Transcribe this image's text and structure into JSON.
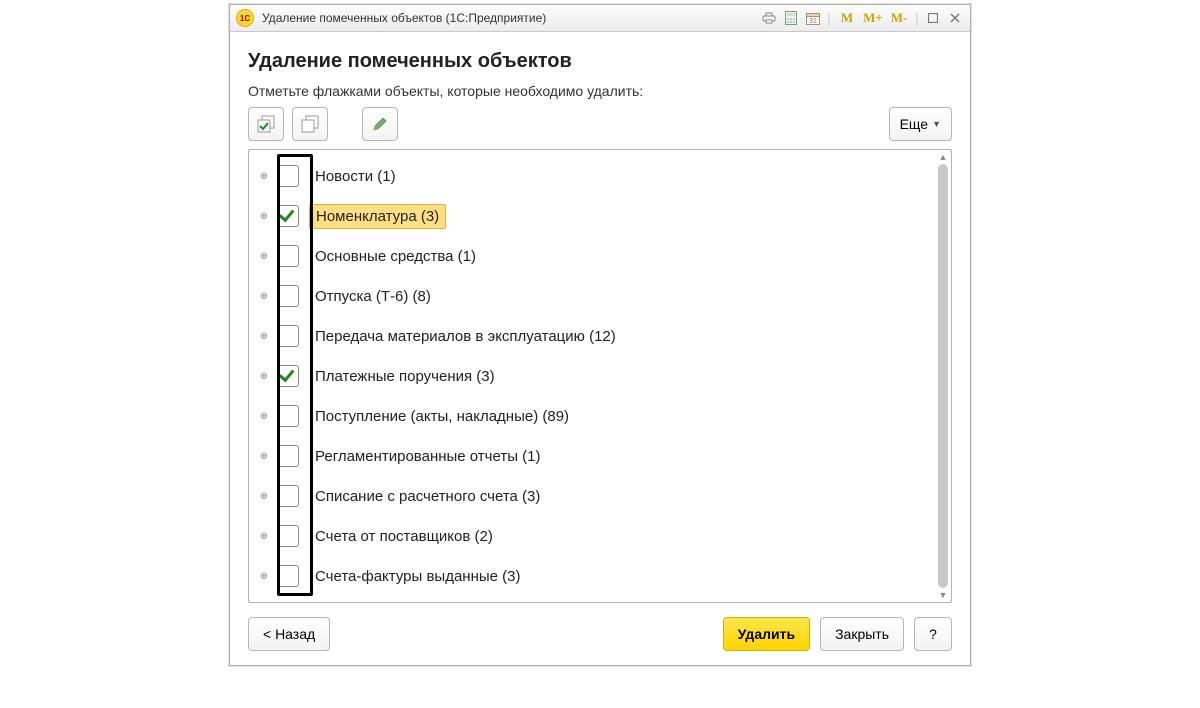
{
  "title": "Удаление помеченных объектов  (1С:Предприятие)",
  "heading": "Удаление помеченных объектов",
  "instruction": "Отметьте флажками объекты, которые необходимо удалить:",
  "more_label": "Еще",
  "items": [
    {
      "checked": false,
      "highlighted": false,
      "label": "Новости (1)"
    },
    {
      "checked": true,
      "highlighted": true,
      "label": "Номенклатура (3)"
    },
    {
      "checked": false,
      "highlighted": false,
      "label": "Основные средства (1)"
    },
    {
      "checked": false,
      "highlighted": false,
      "label": "Отпуска (Т-6) (8)"
    },
    {
      "checked": false,
      "highlighted": false,
      "label": "Передача материалов в эксплуатацию (12)"
    },
    {
      "checked": true,
      "highlighted": false,
      "label": "Платежные поручения (3)"
    },
    {
      "checked": false,
      "highlighted": false,
      "label": "Поступление (акты, накладные) (89)"
    },
    {
      "checked": false,
      "highlighted": false,
      "label": "Регламентированные отчеты (1)"
    },
    {
      "checked": false,
      "highlighted": false,
      "label": "Списание с расчетного счета (3)"
    },
    {
      "checked": false,
      "highlighted": false,
      "label": "Счета от поставщиков (2)"
    },
    {
      "checked": false,
      "highlighted": false,
      "label": "Счета-фактуры выданные (3)"
    }
  ],
  "footer": {
    "back": "< Назад",
    "delete": "Удалить",
    "close": "Закрыть",
    "help": "?"
  },
  "titlebar_m": {
    "m": "M",
    "mp": "M+",
    "mm": "M-"
  }
}
